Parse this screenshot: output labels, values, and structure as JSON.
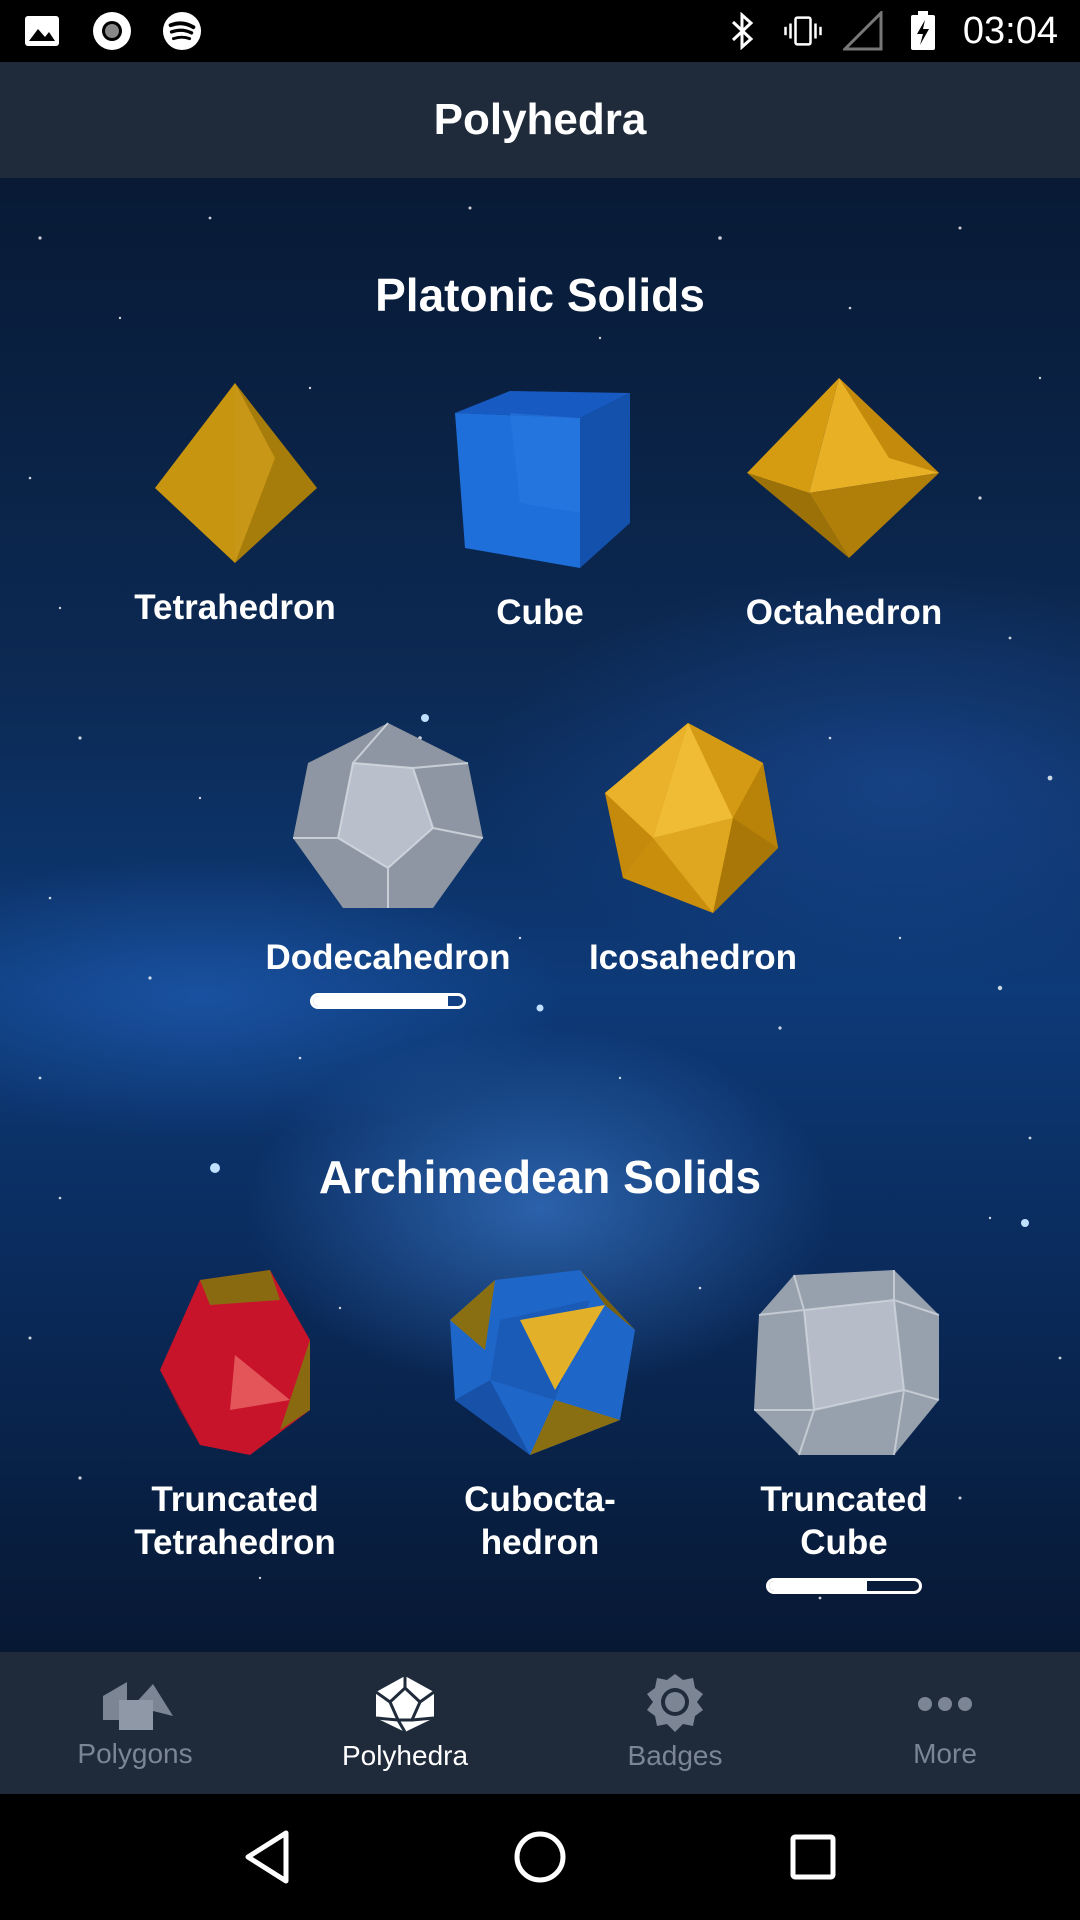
{
  "status_bar": {
    "time": "03:04",
    "left_icons": [
      "image-icon",
      "record-icon",
      "spotify-icon"
    ],
    "right_icons": [
      "bluetooth-icon",
      "vibrate-icon",
      "signal-icon",
      "battery-charging-icon"
    ]
  },
  "app_bar": {
    "title": "Polyhedra"
  },
  "sections": {
    "platonic": {
      "title": "Platonic Solids",
      "items": [
        {
          "label": "Tetrahedron",
          "color": "#d9a21c"
        },
        {
          "label": "Cube",
          "color": "#1e6fd9"
        },
        {
          "label": "Octahedron",
          "color": "#e0a81a"
        },
        {
          "label": "Dodecahedron",
          "color": "#a9b1bd",
          "progress": 0.9
        },
        {
          "label": "Icosahedron",
          "color": "#e6aa16"
        }
      ]
    },
    "archimedean": {
      "title": "Archimedean Solids",
      "items": [
        {
          "label": "Truncated Tetrahedron",
          "line1": "Truncated",
          "line2": "Tetrahedron",
          "color": "#c8142a"
        },
        {
          "label": "Cubocta-hedron",
          "line1": "Cubocta-",
          "line2": "hedron",
          "color": "#1f66c9"
        },
        {
          "label": "Truncated Cube",
          "line1": "Truncated",
          "line2": "Cube",
          "color": "#a9b1bd",
          "progress": 0.65
        }
      ]
    }
  },
  "bottom_nav": [
    {
      "label": "Polygons",
      "icon": "polygons-icon",
      "active": false
    },
    {
      "label": "Polyhedra",
      "icon": "polyhedra-icon",
      "active": true
    },
    {
      "label": "Badges",
      "icon": "badge-icon",
      "active": false
    },
    {
      "label": "More",
      "icon": "more-icon",
      "active": false
    }
  ],
  "system_nav": [
    "back-icon",
    "home-icon",
    "recents-icon"
  ]
}
